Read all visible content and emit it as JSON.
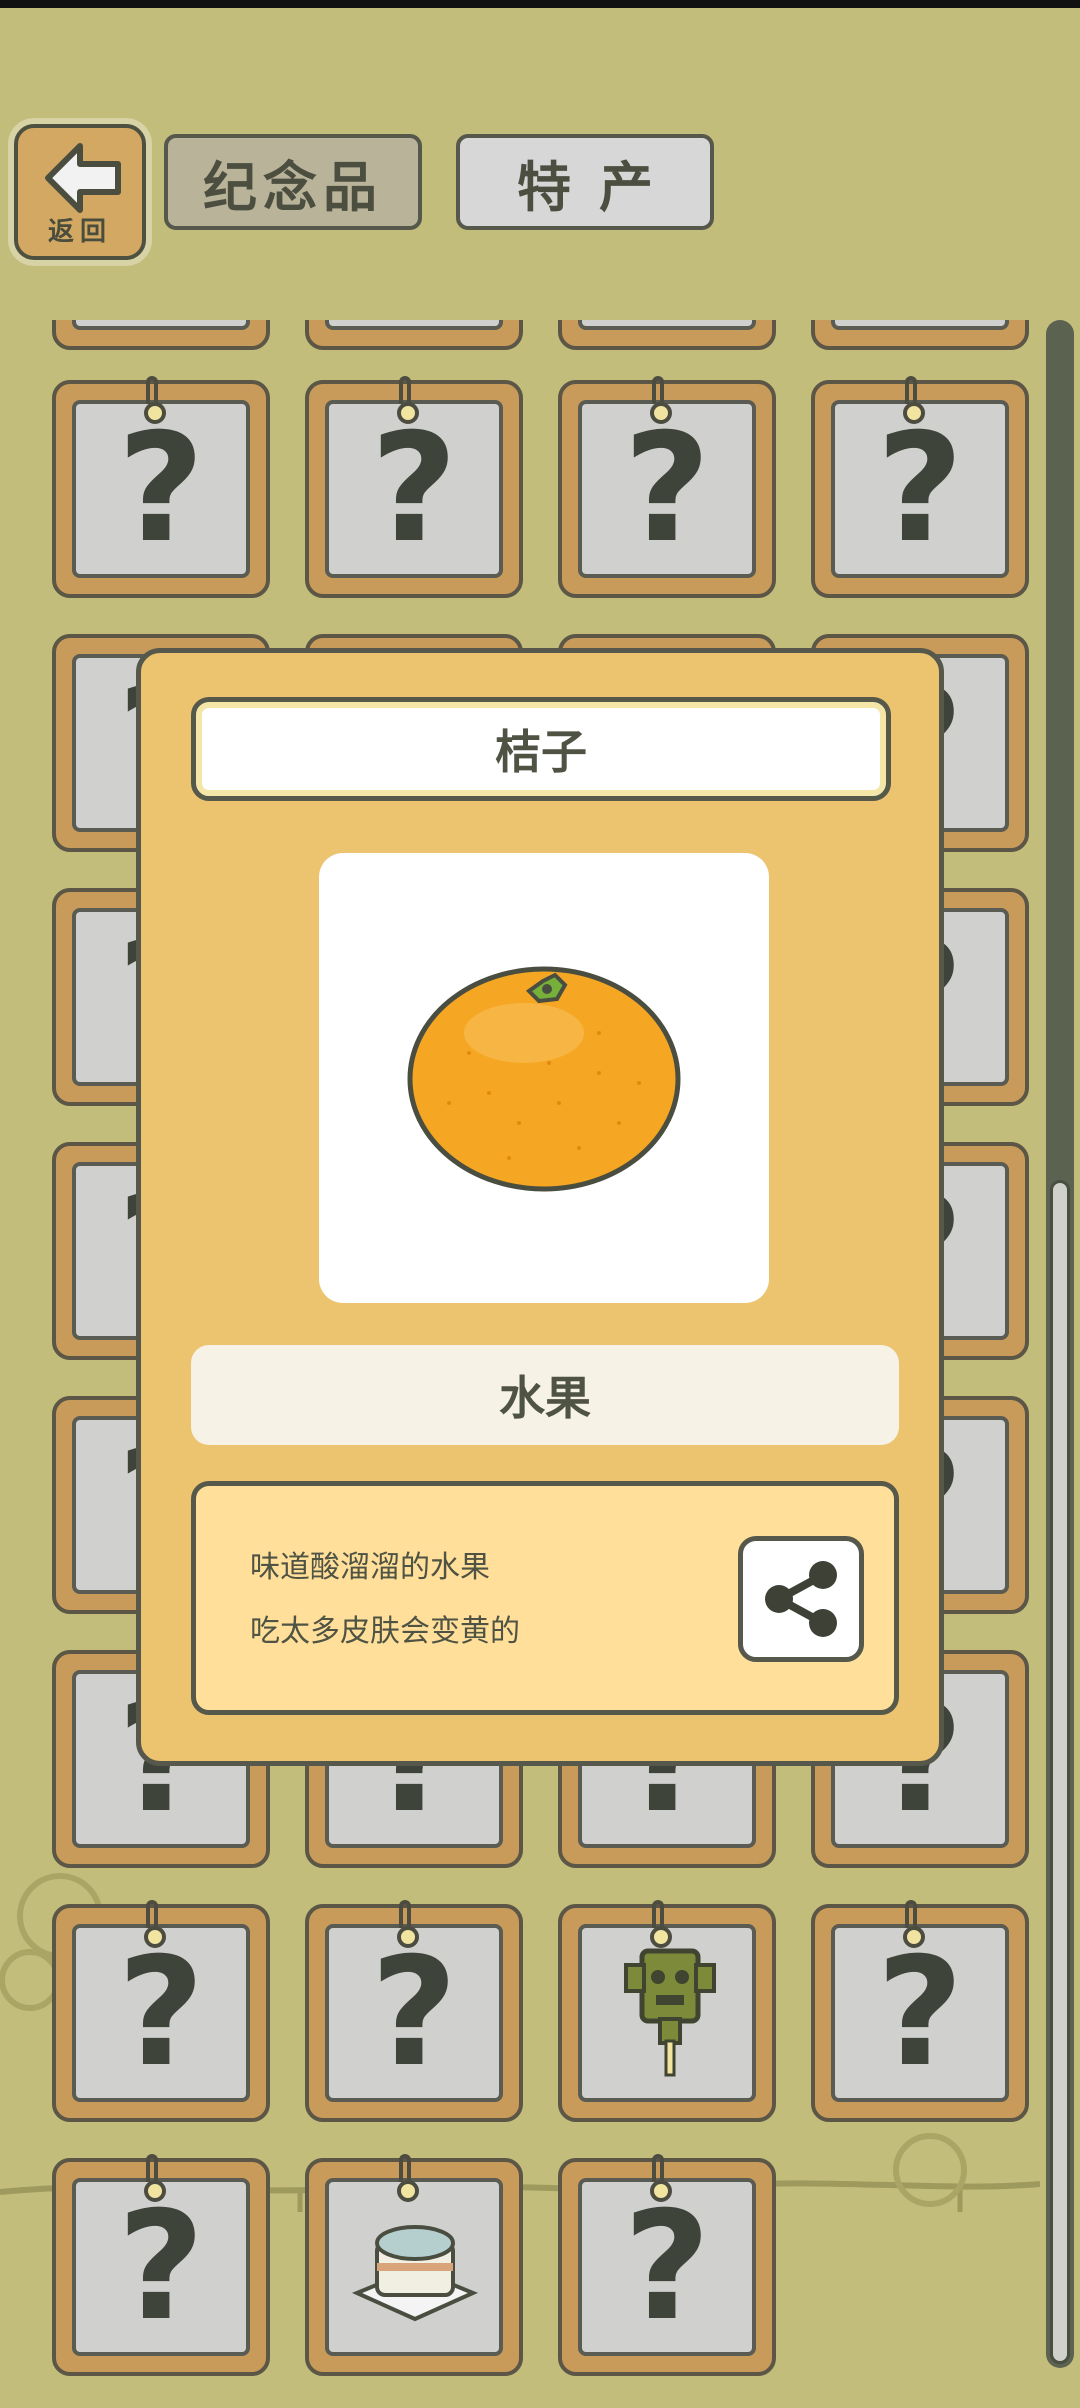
{
  "header": {
    "back_label": "返回",
    "tab_souvenir": "纪念品",
    "tab_specialty": "特产"
  },
  "grid": {
    "unknown_symbol": "?"
  },
  "modal": {
    "item_name": "桔子",
    "category": "水果",
    "description_line1": "味道酸溜溜的水果",
    "description_line2": "吃太多皮肤会变黄的",
    "image_icon": "orange-icon",
    "share_icon": "share-icon"
  },
  "colors": {
    "background": "#c2bd7a",
    "modal": "#ecc470",
    "frame": "#c99b5b"
  }
}
